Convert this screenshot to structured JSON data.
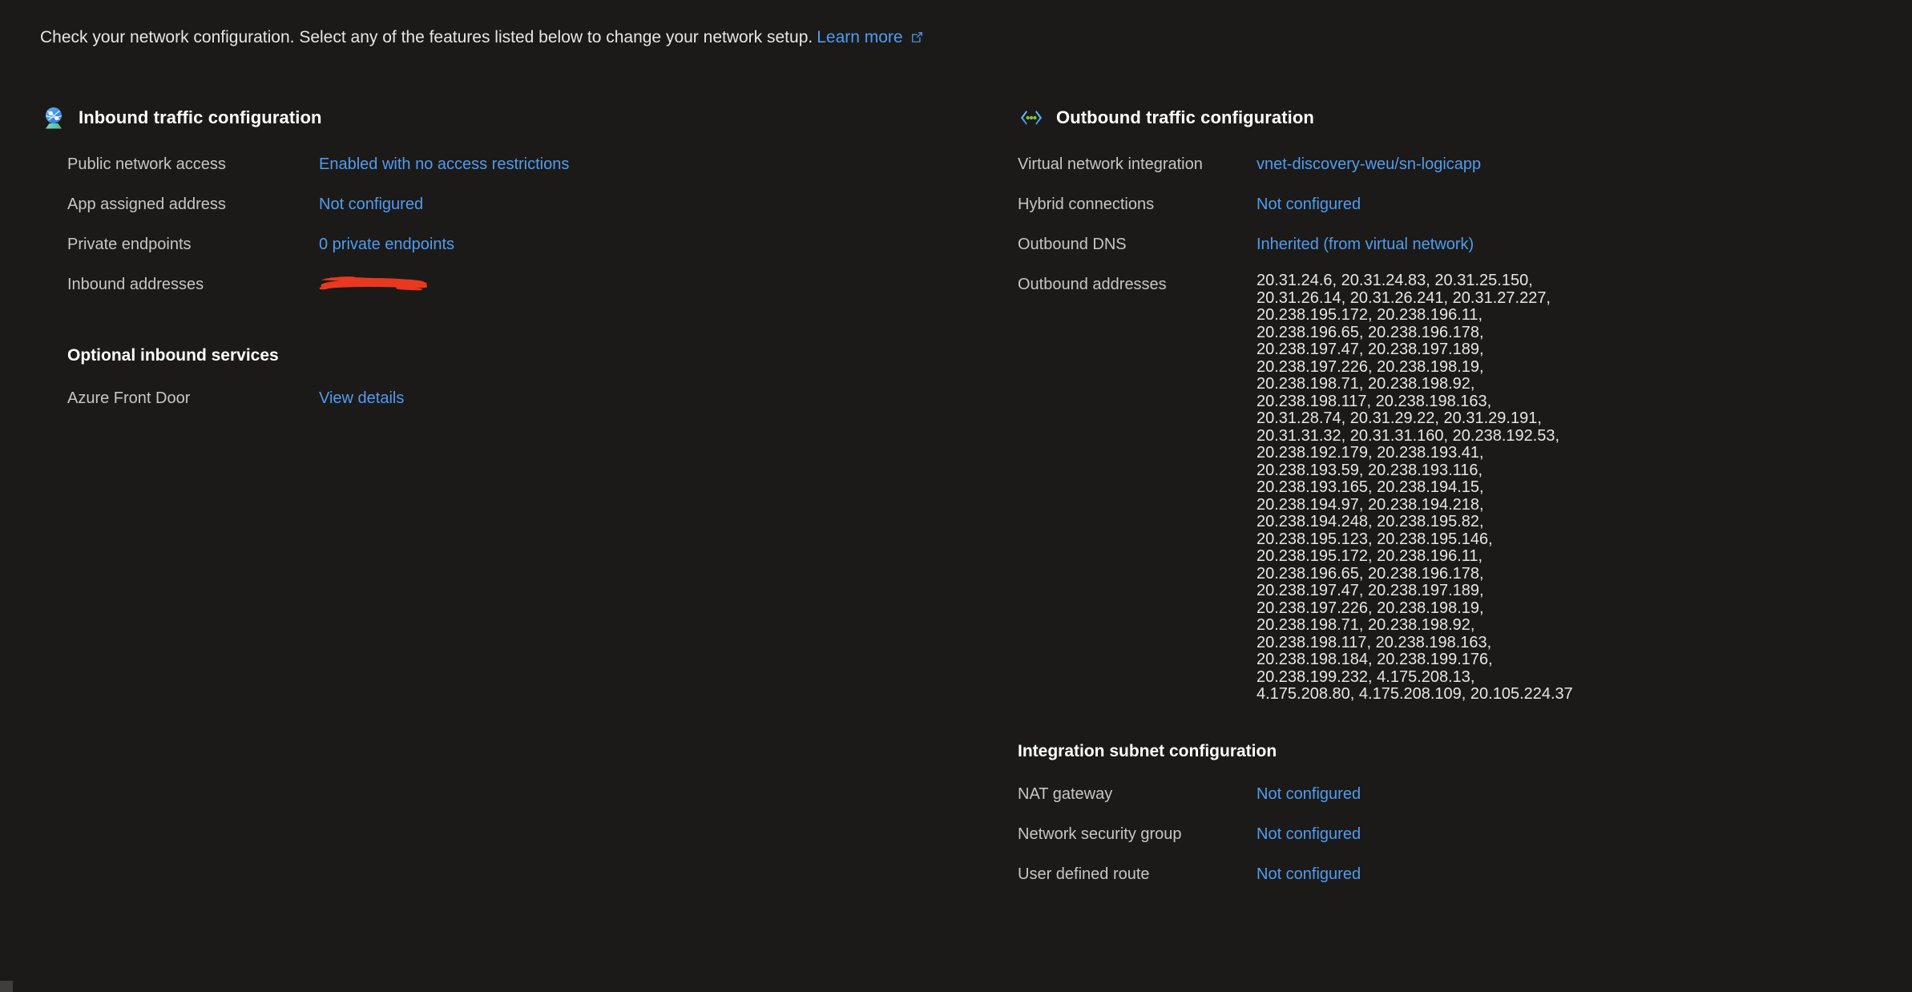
{
  "banner": {
    "text": "Check your network configuration. Select any of the features listed below to change your network setup.",
    "learn_more_label": "Learn more",
    "external_link_icon": "external-link-icon",
    "link_color": "#4f9cef"
  },
  "inbound": {
    "icon": "network-globe-icon",
    "title": "Inbound traffic configuration",
    "rows": [
      {
        "label": "Public network access",
        "value": "Enabled with no access restrictions",
        "kind": "link"
      },
      {
        "label": "App assigned address",
        "value": "Not configured",
        "kind": "link"
      },
      {
        "label": "Private endpoints",
        "value": "0 private endpoints",
        "kind": "link"
      },
      {
        "label": "Inbound addresses",
        "value": "",
        "kind": "redacted"
      }
    ],
    "optional": {
      "title": "Optional inbound services",
      "rows": [
        {
          "label": "Azure Front Door",
          "value": "View details",
          "kind": "link"
        }
      ]
    }
  },
  "outbound": {
    "icon": "outbound-arrows-icon",
    "title": "Outbound traffic configuration",
    "rows": [
      {
        "label": "Virtual network integration",
        "value": "vnet-discovery-weu/sn-logicapp",
        "kind": "link"
      },
      {
        "label": "Hybrid connections",
        "value": "Not configured",
        "kind": "link"
      },
      {
        "label": "Outbound DNS",
        "value": "Inherited (from virtual network)",
        "kind": "link"
      }
    ],
    "outbound_addresses": {
      "label": "Outbound addresses",
      "value": "20.31.24.6, 20.31.24.83, 20.31.25.150, 20.31.26.14, 20.31.26.241, 20.31.27.227, 20.238.195.172, 20.238.196.11, 20.238.196.65, 20.238.196.178, 20.238.197.47, 20.238.197.189, 20.238.197.226, 20.238.198.19, 20.238.198.71, 20.238.198.92, 20.238.198.117, 20.238.198.163, 20.31.28.74, 20.31.29.22, 20.31.29.191, 20.31.31.32, 20.31.31.160, 20.238.192.53, 20.238.192.179, 20.238.193.41, 20.238.193.59, 20.238.193.116, 20.238.193.165, 20.238.194.15, 20.238.194.97, 20.238.194.218, 20.238.194.248, 20.238.195.82, 20.238.195.123, 20.238.195.146, 20.238.195.172, 20.238.196.11, 20.238.196.65, 20.238.196.178, 20.238.197.47, 20.238.197.189, 20.238.197.226, 20.238.198.19, 20.238.198.71, 20.238.198.92, 20.238.198.117, 20.238.198.163, 20.238.198.184, 20.238.199.176, 20.238.199.232, 4.175.208.13, 4.175.208.80, 4.175.208.109, 20.105.224.37"
    },
    "integration_subnet": {
      "title": "Integration subnet configuration",
      "rows": [
        {
          "label": "NAT gateway",
          "value": "Not configured",
          "kind": "link"
        },
        {
          "label": "Network security group",
          "value": "Not configured",
          "kind": "link"
        },
        {
          "label": "User defined route",
          "value": "Not configured",
          "kind": "link"
        }
      ]
    }
  },
  "redaction": {
    "name": "redaction-mark",
    "color": "#e8391f"
  },
  "scrollbar": {
    "name": "horizontal-scrollbar",
    "thumb_color": "#3f3e3d"
  }
}
